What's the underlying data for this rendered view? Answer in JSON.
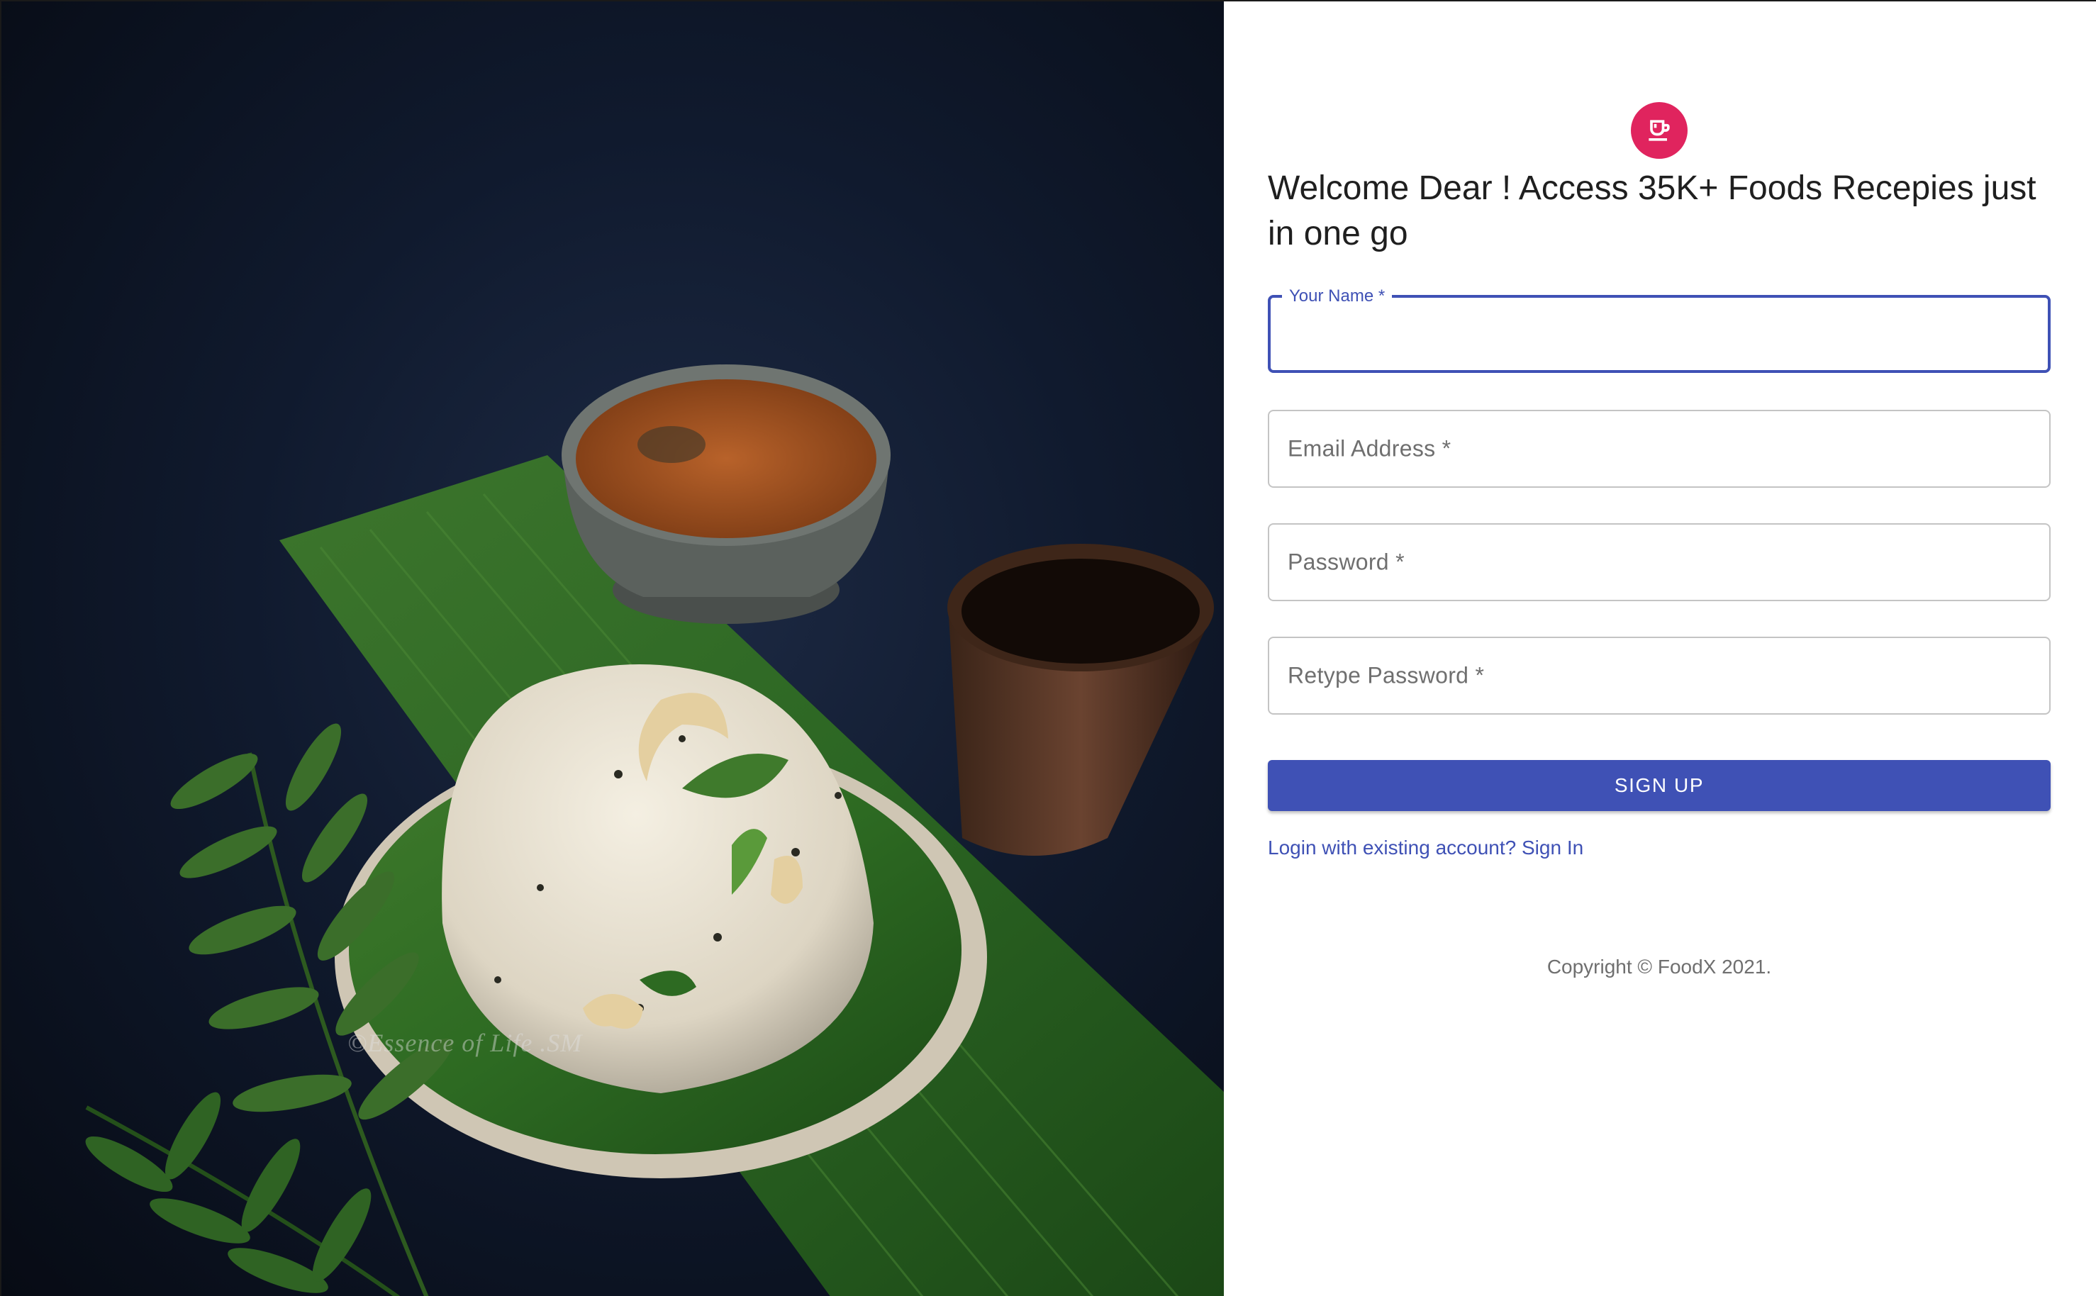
{
  "hero": {
    "watermark": "©Essence of Life .SM"
  },
  "brand": {
    "logo_icon": "coffee-cup-icon",
    "accent_color": "#e0245e"
  },
  "headline": "Welcome Dear ! Access 35K+ Foods Recepies just in one go",
  "form": {
    "name_label": "Your Name *",
    "name_value": "",
    "email_label": "Email Address *",
    "password_label": "Password *",
    "retype_password_label": "Retype Password *",
    "submit_label": "SIGN UP",
    "primary_color": "#3f51b5"
  },
  "login_link": "Login with existing account? Sign In",
  "copyright": "Copyright © FoodX 2021."
}
